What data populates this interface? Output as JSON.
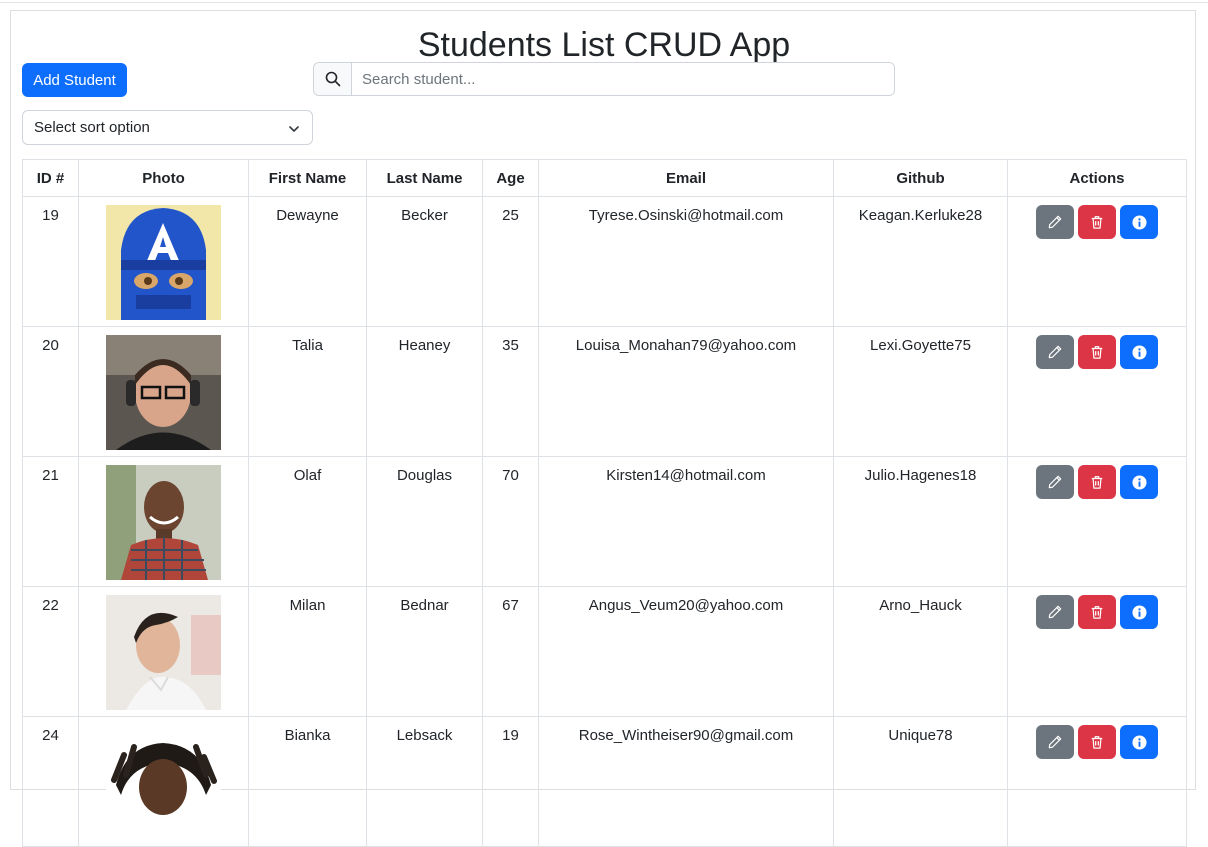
{
  "app": {
    "title": "Students List CRUD App"
  },
  "toolbar": {
    "add_label": "Add Student",
    "search_placeholder": "Search student...",
    "sort_placeholder": "Select sort option"
  },
  "table": {
    "headers": {
      "id": "ID #",
      "photo": "Photo",
      "first_name": "First Name",
      "last_name": "Last Name",
      "age": "Age",
      "email": "Email",
      "github": "Github",
      "actions": "Actions"
    },
    "rows": [
      {
        "id": "19",
        "first_name": "Dewayne",
        "last_name": "Becker",
        "age": "25",
        "email": "Tyrese.Osinski@hotmail.com",
        "github": "Keagan.Kerluke28"
      },
      {
        "id": "20",
        "first_name": "Talia",
        "last_name": "Heaney",
        "age": "35",
        "email": "Louisa_Monahan79@yahoo.com",
        "github": "Lexi.Goyette75"
      },
      {
        "id": "21",
        "first_name": "Olaf",
        "last_name": "Douglas",
        "age": "70",
        "email": "Kirsten14@hotmail.com",
        "github": "Julio.Hagenes18"
      },
      {
        "id": "22",
        "first_name": "Milan",
        "last_name": "Bednar",
        "age": "67",
        "email": "Angus_Veum20@yahoo.com",
        "github": "Arno_Hauck"
      },
      {
        "id": "24",
        "first_name": "Bianka",
        "last_name": "Lebsack",
        "age": "19",
        "email": "Rose_Wintheiser90@gmail.com",
        "github": "Unique78"
      }
    ]
  },
  "icons": {
    "search": "search-icon",
    "sort": "chevron-down-icon",
    "edit": "pencil-icon",
    "delete": "trash-icon",
    "info": "info-icon"
  },
  "colors": {
    "primary": "#0d6efd",
    "secondary": "#6c757d",
    "danger": "#dc3545"
  }
}
